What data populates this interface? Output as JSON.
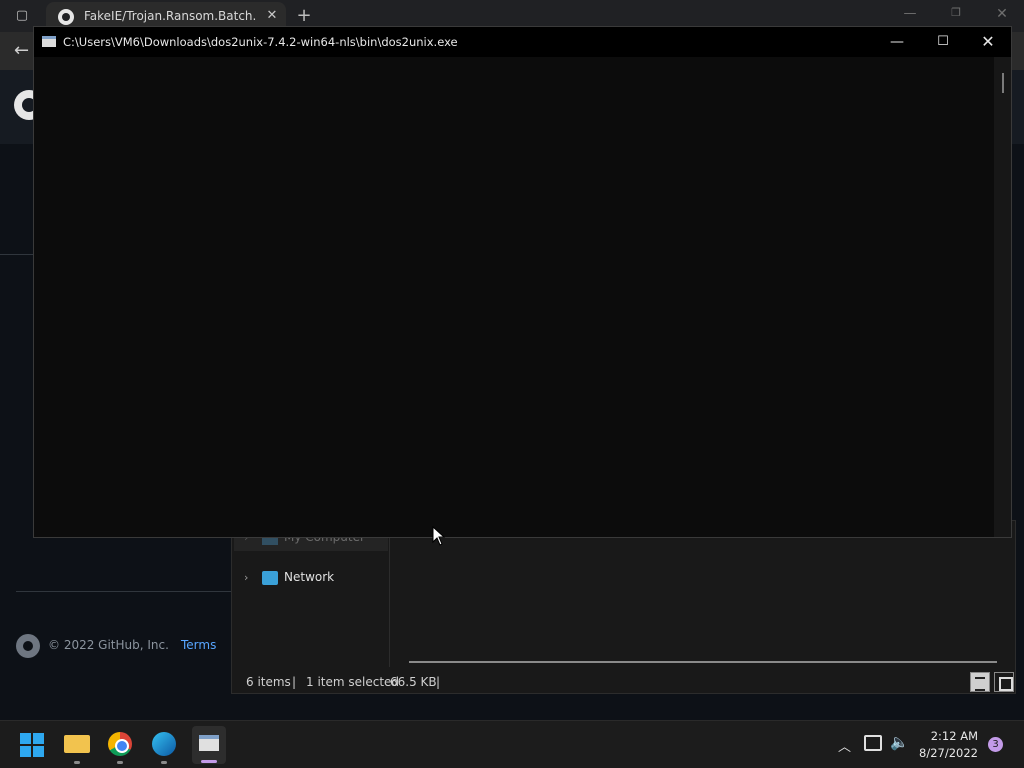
{
  "browser": {
    "tab_title": "FakeIE/Trojan.Ransom.Batch.Fake",
    "tab_close": "✕",
    "new_tab": "+"
  },
  "github": {
    "footer_copyright": "© 2022 GitHub, Inc.",
    "footer_terms": "Terms"
  },
  "explorer": {
    "nav_items": [
      {
        "label": "My Computer"
      },
      {
        "label": "Network"
      }
    ],
    "status": {
      "item_count": "6 items",
      "separator": "|",
      "selected": "1 item selected",
      "size": "66.5 KB"
    }
  },
  "console": {
    "title": "C:\\Users\\VM6\\Downloads\\dos2unix-7.4.2-win64-nls\\bin\\dos2unix.exe",
    "minimize": "—",
    "maximize": "☐",
    "close": "✕"
  },
  "taskbar": {
    "clock_time": "2:12 AM",
    "clock_date": "8/27/2022",
    "notification_count": "3"
  },
  "icons": {
    "accent": "#c39be8",
    "start_color": "#2ea8f0"
  }
}
